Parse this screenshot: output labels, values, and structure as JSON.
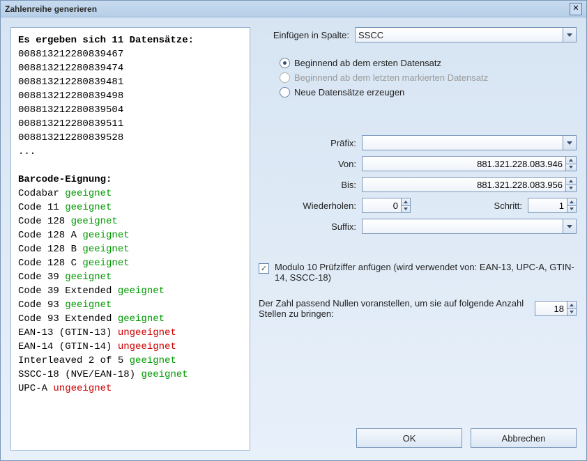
{
  "window": {
    "title": "Zahlenreihe generieren"
  },
  "preview": {
    "heading": "Es ergeben sich 11 Datensätze:",
    "numbers": [
      "008813212280839467",
      "008813212280839474",
      "008813212280839481",
      "008813212280839498",
      "008813212280839504",
      "008813212280839511",
      "008813212280839528"
    ],
    "ellipsis": "...",
    "suit_heading": "Barcode-Eignung:",
    "suitability": [
      {
        "name": "Codabar",
        "status": "geeignet",
        "ok": true
      },
      {
        "name": "Code 11",
        "status": "geeignet",
        "ok": true
      },
      {
        "name": "Code 128",
        "status": "geeignet",
        "ok": true
      },
      {
        "name": "Code 128 A",
        "status": "geeignet",
        "ok": true
      },
      {
        "name": "Code 128 B",
        "status": "geeignet",
        "ok": true
      },
      {
        "name": "Code 128 C",
        "status": "geeignet",
        "ok": true
      },
      {
        "name": "Code 39",
        "status": "geeignet",
        "ok": true
      },
      {
        "name": "Code 39 Extended",
        "status": "geeignet",
        "ok": true
      },
      {
        "name": "Code 93",
        "status": "geeignet",
        "ok": true
      },
      {
        "name": "Code 93 Extended",
        "status": "geeignet",
        "ok": true
      },
      {
        "name": "EAN-13 (GTIN-13)",
        "status": "ungeeignet",
        "ok": false
      },
      {
        "name": "EAN-14 (GTIN-14)",
        "status": "ungeeignet",
        "ok": false
      },
      {
        "name": "Interleaved 2 of 5",
        "status": "geeignet",
        "ok": true
      },
      {
        "name": "SSCC-18 (NVE/EAN-18)",
        "status": "geeignet",
        "ok": true
      },
      {
        "name": "UPC-A",
        "status": "ungeeignet",
        "ok": false
      }
    ]
  },
  "form": {
    "insert_label": "Einfügen in Spalte:",
    "insert_value": "SSCC",
    "radios": {
      "first": "Beginnend ab dem ersten Datensatz",
      "last": "Beginnend ab dem letzten markierten Datensatz",
      "new": "Neue Datensätze erzeugen"
    },
    "prefix_label": "Präfix:",
    "prefix_value": "",
    "from_label": "Von:",
    "from_value": "881.321.228.083.946",
    "to_label": "Bis:",
    "to_value": "881.321.228.083.956",
    "repeat_label": "Wiederholen:",
    "repeat_value": "0",
    "step_label": "Schritt:",
    "step_value": "1",
    "suffix_label": "Suffix:",
    "suffix_value": "",
    "mod10_label": "Modulo 10 Prüfziffer anfügen (wird verwendet von: EAN-13, UPC-A, GTIN-14, SSCC-18)",
    "zeropad_label": "Der Zahl passend Nullen voranstellen, um sie auf folgende Anzahl Stellen zu bringen:",
    "zeropad_value": "18"
  },
  "buttons": {
    "ok": "OK",
    "cancel": "Abbrechen"
  }
}
